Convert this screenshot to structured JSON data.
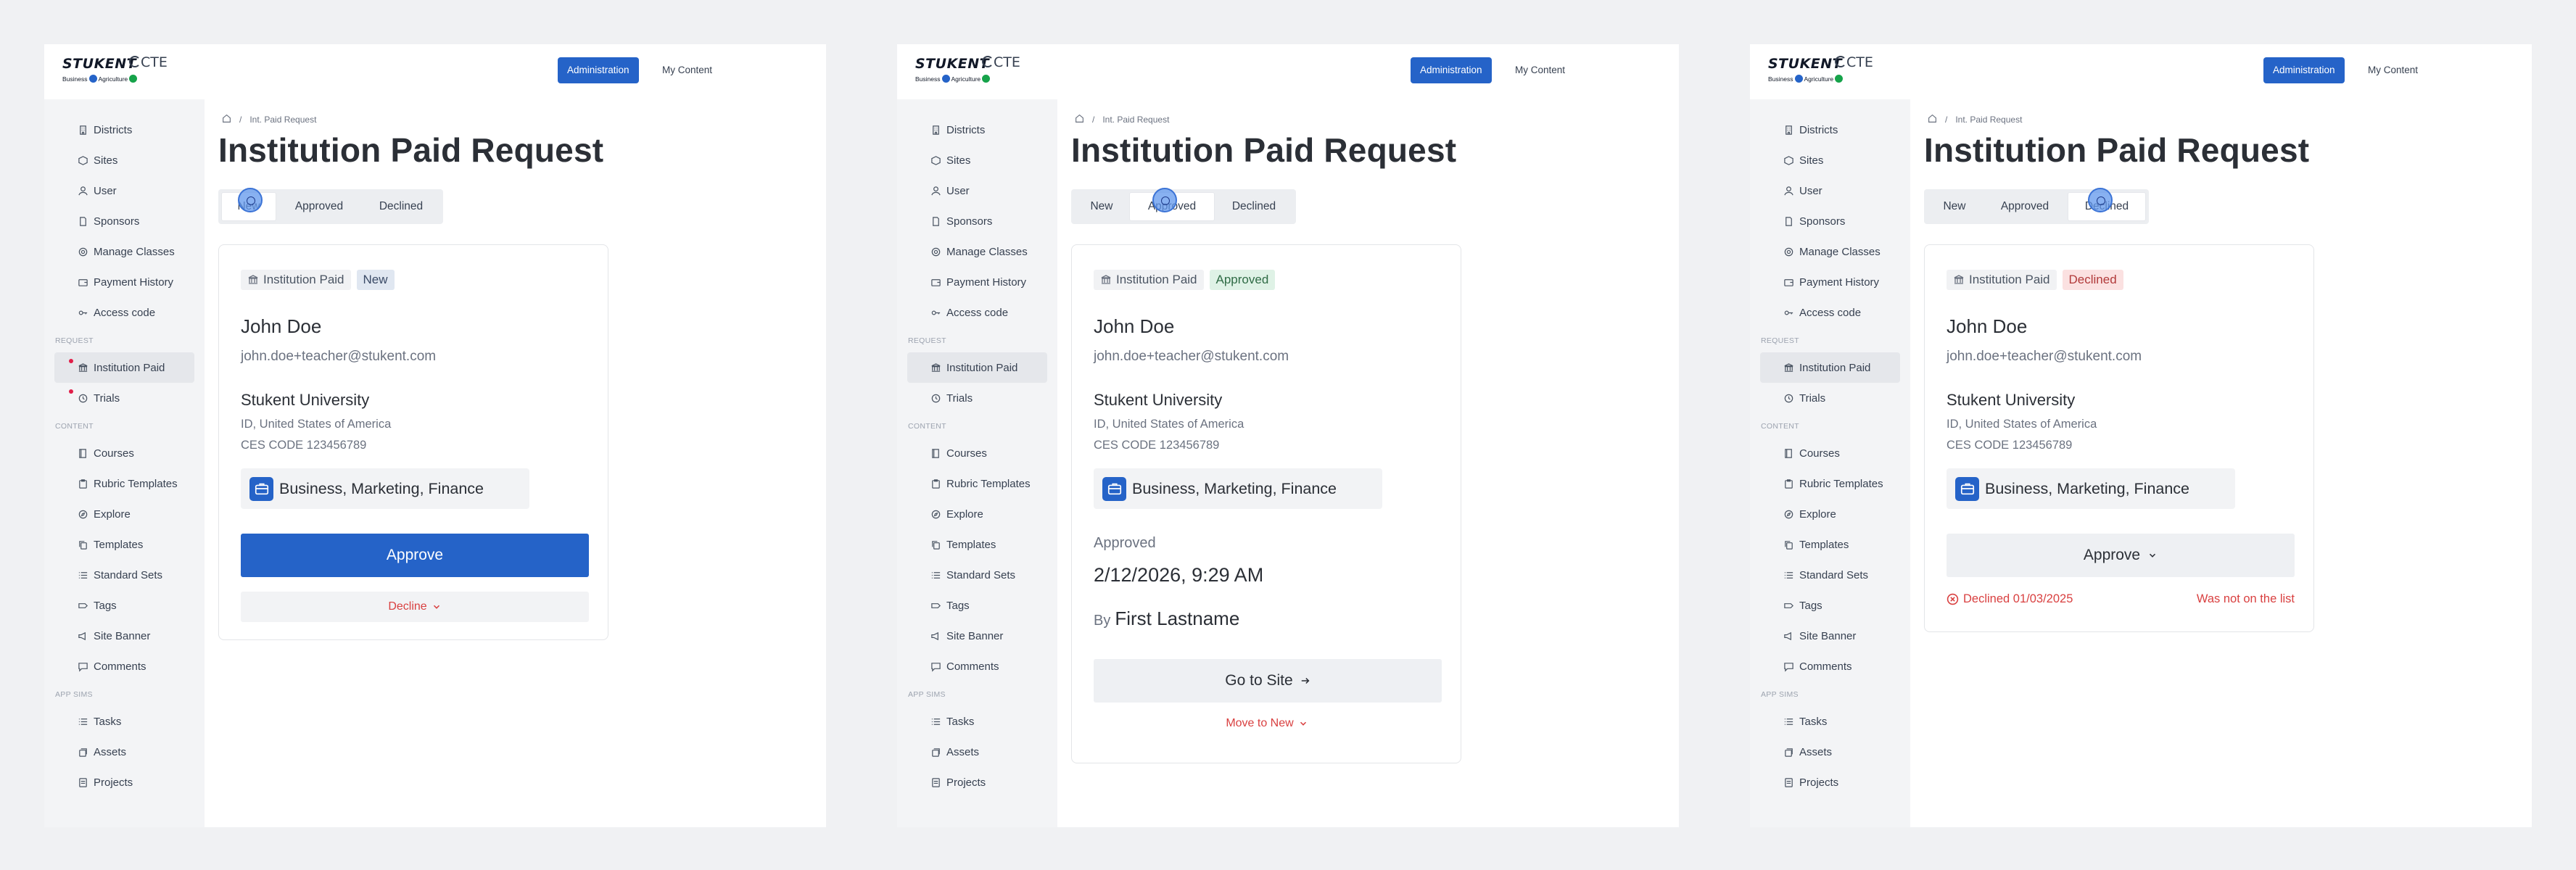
{
  "brand": {
    "name": "STUKENT",
    "product": "CTE",
    "sub_1": "Business",
    "sub_2": "Agriculture",
    "dot_colors": [
      "#2563c8",
      "#16a34a"
    ]
  },
  "topnav": {
    "admin_label": "Administration",
    "content_label": "My Content"
  },
  "sidebar": {
    "items_top": [
      {
        "label": "Districts",
        "icon": "building-icon"
      },
      {
        "label": "Sites",
        "icon": "cube-icon"
      },
      {
        "label": "User",
        "icon": "user-icon"
      },
      {
        "label": "Sponsors",
        "icon": "document-icon"
      },
      {
        "label": "Manage Classes",
        "icon": "gear-icon"
      },
      {
        "label": "Payment History",
        "icon": "wallet-icon"
      },
      {
        "label": "Access code",
        "icon": "key-icon"
      }
    ],
    "section_request": "REQUEST",
    "items_request": [
      {
        "label": "Institution Paid",
        "icon": "bank-icon"
      },
      {
        "label": "Trials",
        "icon": "clock-icon"
      }
    ],
    "section_content": "CONTENT",
    "items_content": [
      {
        "label": "Courses",
        "icon": "book-icon"
      },
      {
        "label": "Rubric Templates",
        "icon": "clipboard-icon"
      },
      {
        "label": "Explore",
        "icon": "compass-icon"
      },
      {
        "label": "Templates",
        "icon": "copy-icon"
      },
      {
        "label": "Standard Sets",
        "icon": "list-icon"
      },
      {
        "label": "Tags",
        "icon": "tag-icon"
      },
      {
        "label": "Site Banner",
        "icon": "megaphone-icon"
      },
      {
        "label": "Comments",
        "icon": "chat-icon"
      }
    ],
    "section_appsims": "APP SIMS",
    "items_appsims": [
      {
        "label": "Tasks",
        "icon": "list-icon"
      },
      {
        "label": "Assets",
        "icon": "layers-icon"
      },
      {
        "label": "Projects",
        "icon": "folder-icon"
      }
    ]
  },
  "page": {
    "breadcrumb": "Int. Paid Request",
    "title": "Institution Paid Request",
    "tabs": [
      "New",
      "Approved",
      "Declined"
    ]
  },
  "request": {
    "type_badge": "Institution Paid",
    "name": "John Doe",
    "email": "john.doe+teacher@stukent.com",
    "org": "Stukent University",
    "address": "ID, United States of America",
    "ces_code": "CES CODE 123456789",
    "cluster": "Business, Marketing, Finance"
  },
  "panels": {
    "new": {
      "status": "New",
      "approve_label": "Approve",
      "decline_label": "Decline"
    },
    "approved": {
      "status": "Approved",
      "approved_label": "Approved",
      "approved_date": "2/12/2026, 9:29 AM",
      "by_label": "By",
      "by_name": "First Lastname",
      "go_label": "Go to Site",
      "move_label": "Move to New"
    },
    "declined": {
      "status": "Declined",
      "approve_label": "Approve",
      "declined_date": "Declined 01/03/2025",
      "reason": "Was not on the list"
    }
  }
}
